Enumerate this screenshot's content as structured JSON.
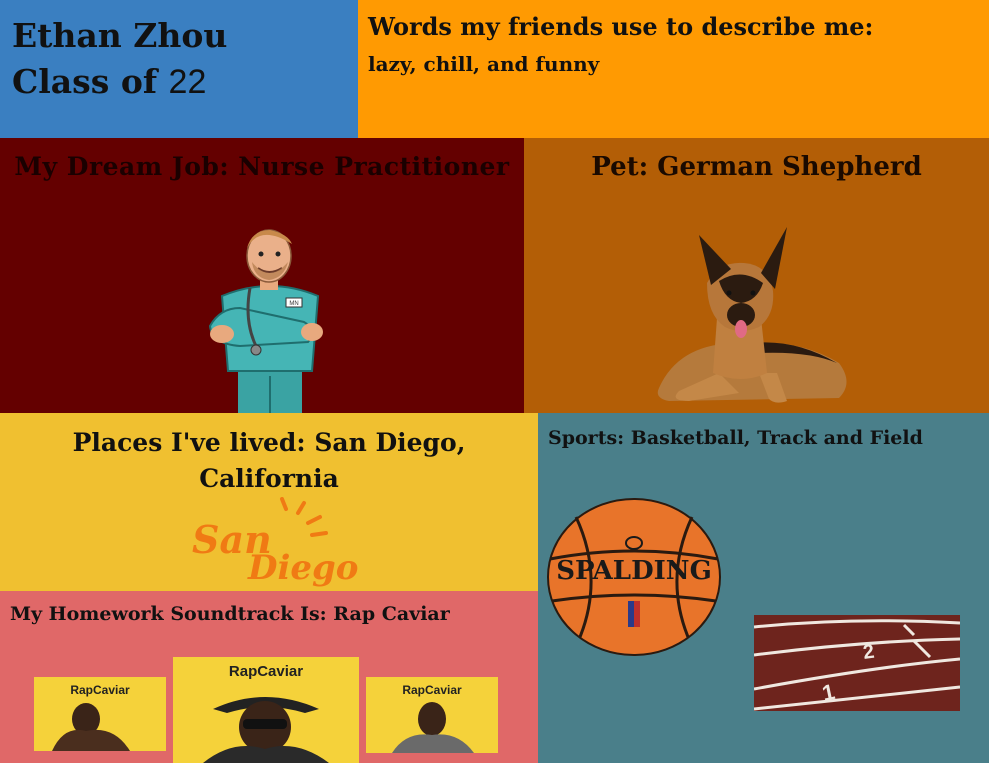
{
  "header": {
    "name": "Ethan Zhou",
    "class_label": "Class of",
    "class_year": "22"
  },
  "words": {
    "title": "Words my friends use to describe me:",
    "list": "lazy, chill, and funny"
  },
  "job": {
    "title": "My Dream Job: Nurse Practitioner",
    "badge": "MN"
  },
  "pet": {
    "title": "Pet: German Shepherd"
  },
  "places": {
    "title": "Places I've lived: San Diego, California",
    "logo_text_1": "San",
    "logo_text_2": "Diego"
  },
  "sports": {
    "title": "Sports: Basketball, Track and Field",
    "ball_brand": "SPALDING"
  },
  "music": {
    "title": "My Homework Soundtrack Is: Rap Caviar",
    "covers": [
      {
        "label": "RapCaviar"
      },
      {
        "label": "RapCaviar"
      },
      {
        "label": "RapCaviar"
      }
    ]
  },
  "colors": {
    "blue": "#3a7fc1",
    "orange": "#ff9a02",
    "maroon": "#640000",
    "brown": "#b35e06",
    "yellow": "#f0c030",
    "teal": "#4a7f8a",
    "salmon": "#e06868"
  }
}
